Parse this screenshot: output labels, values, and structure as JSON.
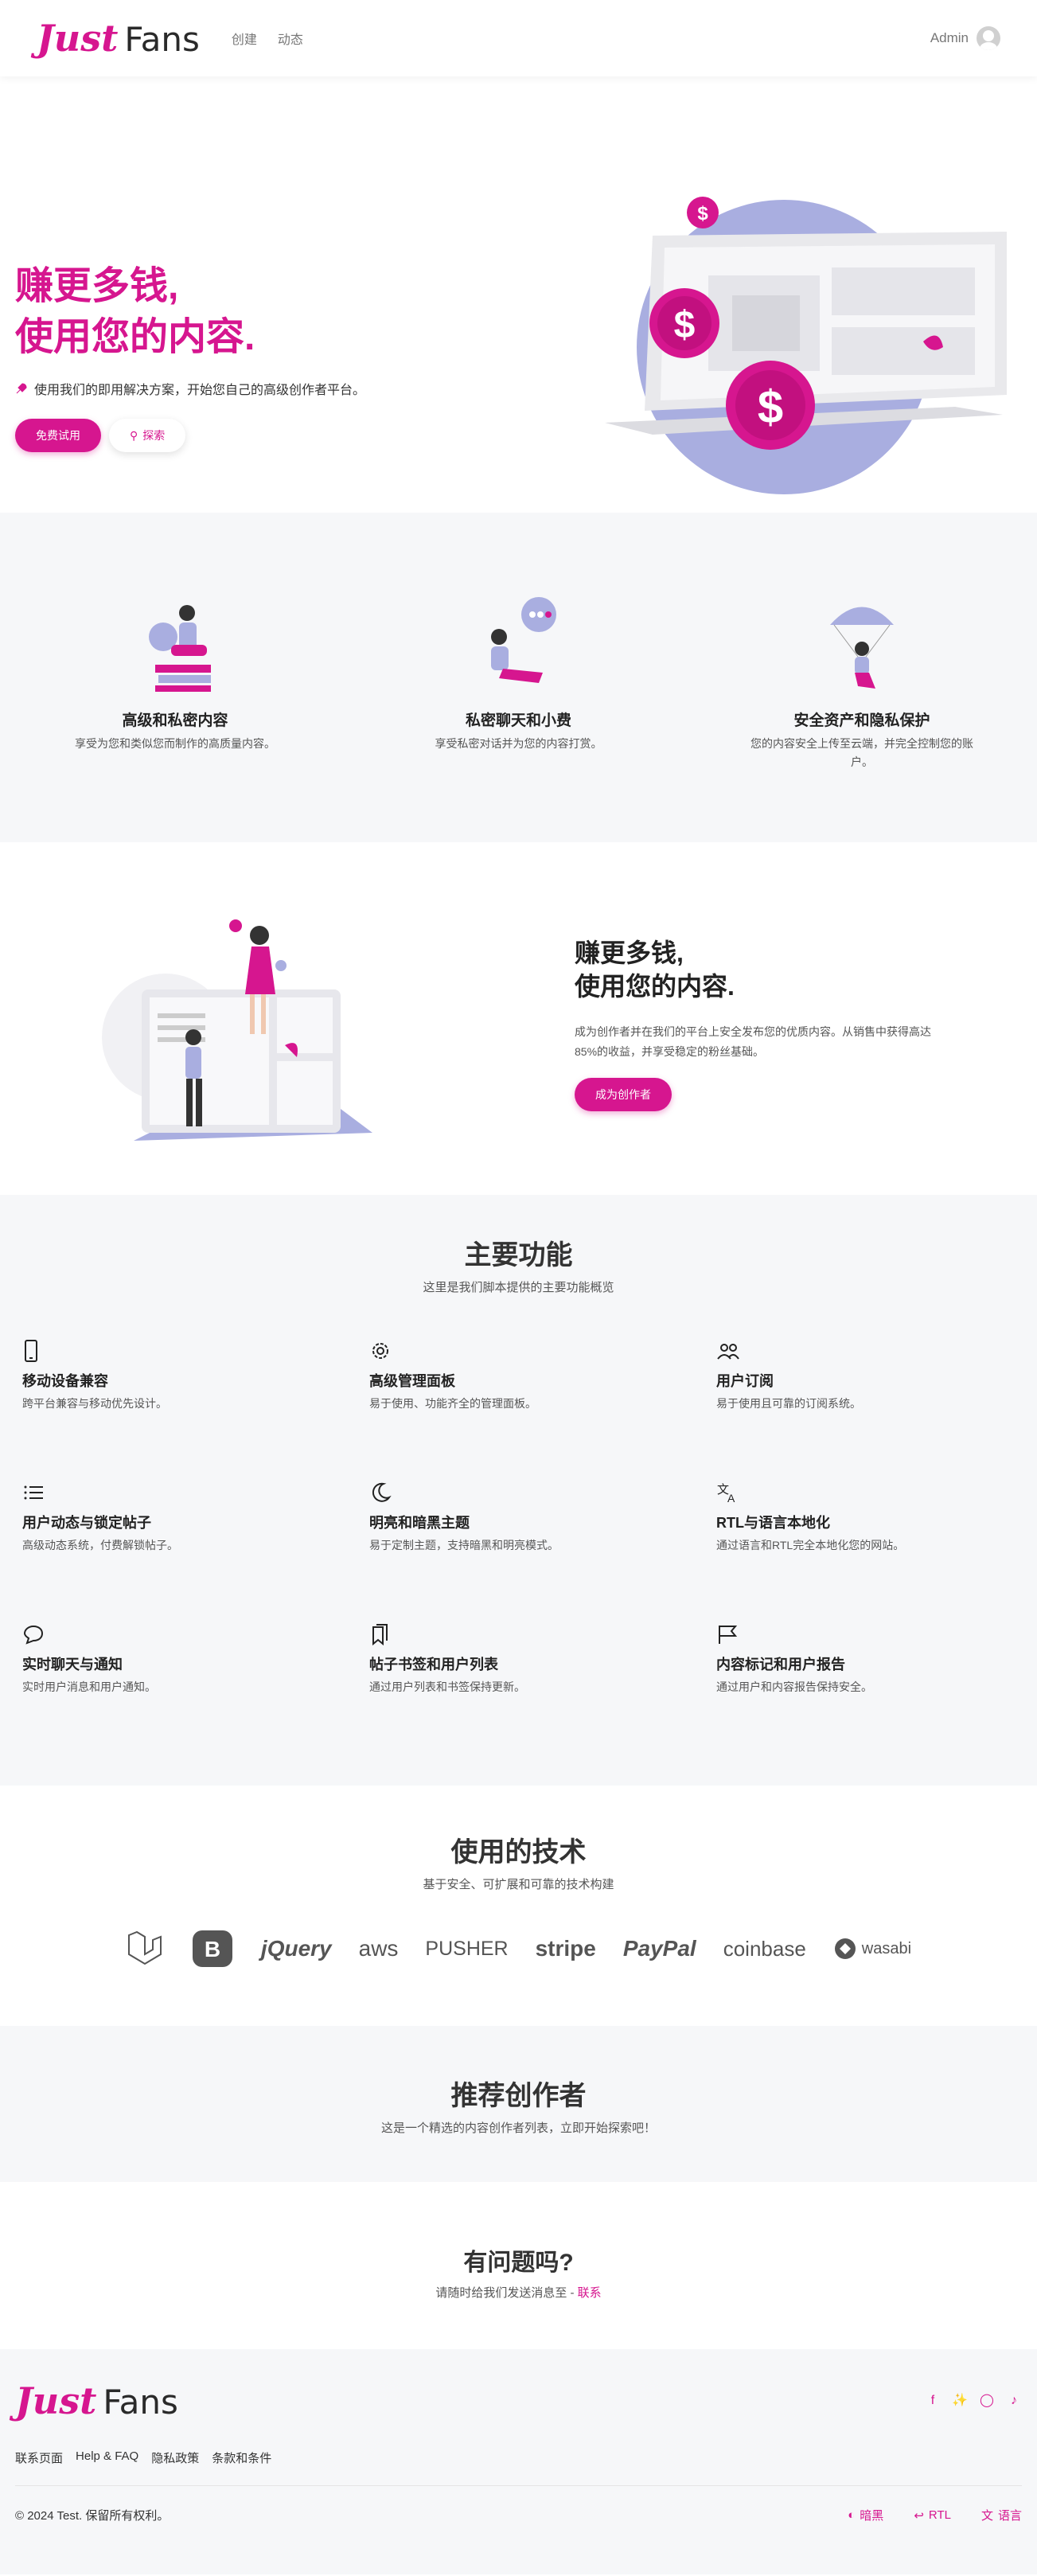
{
  "nav": {
    "logo_just": "Just",
    "logo_fans": "Fans",
    "links": [
      "创建",
      "动态"
    ],
    "user_name": "Admin"
  },
  "hero": {
    "title_line1": "赚更多钱,",
    "title_line2": "使用您的内容.",
    "subtitle": "使用我们的即用解决方案，开始您自己的高级创作者平台。",
    "btn_trial": "免费试用",
    "btn_explore": "探索"
  },
  "three_features": [
    {
      "title": "高级和私密内容",
      "desc": "享受为您和类似您而制作的高质量内容。"
    },
    {
      "title": "私密聊天和小费",
      "desc": "享受私密对话并为您的内容打赏。"
    },
    {
      "title": "安全资产和隐私保护",
      "desc": "您的内容安全上传至云端，并完全控制您的账户。"
    }
  ],
  "creator": {
    "title_line1": "赚更多钱,",
    "title_line2": "使用您的内容.",
    "desc": "成为创作者并在我们的平台上安全发布您的优质内容。从销售中获得高达85%的收益，并享受稳定的粉丝基础。",
    "btn": "成为创作者"
  },
  "main_features": {
    "title": "主要功能",
    "subtitle": "这里是我们脚本提供的主要功能概览",
    "items": [
      {
        "icon": "phone-icon",
        "title": "移动设备兼容",
        "desc": "跨平台兼容与移动优先设计。"
      },
      {
        "icon": "gear-icon",
        "title": "高级管理面板",
        "desc": "易于使用、功能齐全的管理面板。"
      },
      {
        "icon": "users-icon",
        "title": "用户订阅",
        "desc": "易于使用且可靠的订阅系统。"
      },
      {
        "icon": "list-icon",
        "title": "用户动态与锁定帖子",
        "desc": "高级动态系统，付费解锁帖子。"
      },
      {
        "icon": "moon-icon",
        "title": "明亮和暗黑主题",
        "desc": "易于定制主题，支持暗黑和明亮模式。"
      },
      {
        "icon": "translate-icon",
        "title": "RTL与语言本地化",
        "desc": "通过语言和RTL完全本地化您的网站。"
      },
      {
        "icon": "chat-icon",
        "title": "实时聊天与通知",
        "desc": "实时用户消息和用户通知。"
      },
      {
        "icon": "bookmarks-icon",
        "title": "帖子书签和用户列表",
        "desc": "通过用户列表和书签保持更新。"
      },
      {
        "icon": "flag-icon",
        "title": "内容标记和用户报告",
        "desc": "通过用户和内容报告保持安全。"
      }
    ]
  },
  "tech": {
    "title": "使用的技术",
    "subtitle": "基于安全、可扩展和可靠的技术构建",
    "logos": [
      "jQuery",
      "aws",
      "PUSHER",
      "stripe",
      "PayPal",
      "coinbase",
      "wasabi"
    ]
  },
  "recommended": {
    "title": "推荐创作者",
    "subtitle": "这是一个精选的内容创作者列表，立即开始探索吧！"
  },
  "questions": {
    "title": "有问题吗?",
    "text": "请随时给我们发送消息至 -",
    "link": "联系"
  },
  "footer": {
    "links": [
      "联系页面",
      "Help & FAQ",
      "隐私政策",
      "条款和条件"
    ],
    "copyright": "© 2024 Test. 保留所有权利。",
    "dark": "暗黑",
    "rtl": "RTL",
    "lang": "语言"
  },
  "colors": {
    "brand": "#d6168f",
    "accent_lavender": "#a9aee0"
  }
}
